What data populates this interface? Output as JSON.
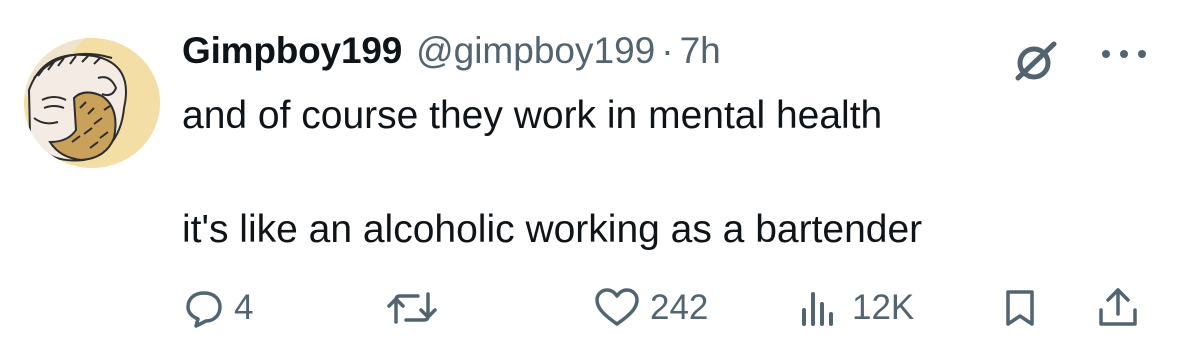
{
  "tweet": {
    "display_name": "Gimpboy199",
    "handle": "@gimpboy199",
    "separator": "·",
    "time": "7h",
    "text_line1": "and of course they work in mental health",
    "text_line2": "it's like an alcoholic working as a bartender"
  },
  "stats": {
    "replies": "4",
    "likes": "242",
    "views": "12K"
  },
  "icons": {
    "avatar": "cartoon-bearded-man-avatar",
    "grok": "grok-icon",
    "more": "more-icon",
    "reply": "reply-icon",
    "retweet": "retweet-icon",
    "like": "heart-icon",
    "views": "views-icon",
    "bookmark": "bookmark-icon",
    "share": "share-icon"
  },
  "colors": {
    "text": "#0f1419",
    "secondary": "#536471",
    "avatar_bg": "#f3dfa6"
  }
}
